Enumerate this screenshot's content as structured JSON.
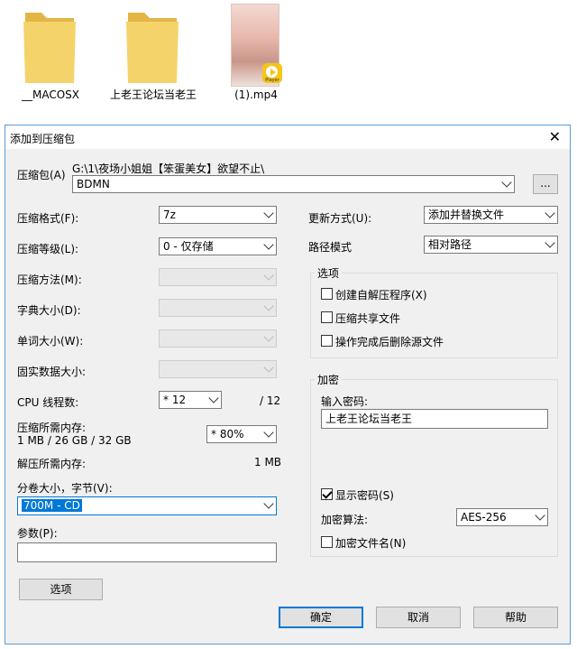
{
  "desktop": {
    "items": [
      {
        "label": "__MACOSX"
      },
      {
        "label": "上老王论坛当老王"
      },
      {
        "label": "(1).mp4",
        "badge": "Player"
      }
    ]
  },
  "dialog": {
    "title": "添加到压缩包",
    "archive_label": "压缩包(A)",
    "archive_path": "G:\\1\\夜场小姐姐【笨蛋美女】欲望不止\\",
    "archive_name": "BDMN",
    "browse_label": "...",
    "format_label": "压缩格式(F):",
    "format_value": "7z",
    "level_label": "压缩等级(L):",
    "level_value": "0 - 仅存储",
    "method_label": "压缩方法(M):",
    "dict_label": "字典大小(D):",
    "word_label": "单词大小(W):",
    "solid_label": "固实数据大小:",
    "cpu_label": "CPU 线程数:",
    "cpu_value": "* 12",
    "cpu_max": "/ 12",
    "mem_label": "压缩所需内存:",
    "mem_detail": "1 MB / 26 GB / 32 GB",
    "mem_value": "* 80%",
    "decomp_label": "解压所需内存:",
    "decomp_value": "1 MB",
    "split_label": "分卷大小，字节(V):",
    "split_value": "700M - CD",
    "params_label": "参数(P):",
    "params_value": "",
    "options_button": "选项",
    "update_label": "更新方式(U):",
    "update_value": "添加并替换文件",
    "path_label": "路径模式",
    "path_value": "相对路径",
    "options_group": "选项",
    "opt_sfx": "创建自解压程序(X)",
    "opt_shared": "压缩共享文件",
    "opt_delete": "操作完成后删除源文件",
    "encrypt_group": "加密",
    "password_label": "输入密码:",
    "password_value": "上老王论坛当老王",
    "show_password": "显示密码(S)",
    "algo_label": "加密算法:",
    "algo_value": "AES-256",
    "encrypt_names": "加密文件名(N)",
    "ok": "确定",
    "cancel": "取消",
    "help": "帮助"
  },
  "colors": {
    "accent": "#0078d7",
    "folder": "#f4d36b",
    "folder_dark": "#e2b545",
    "player_badge": "#f5c518"
  }
}
